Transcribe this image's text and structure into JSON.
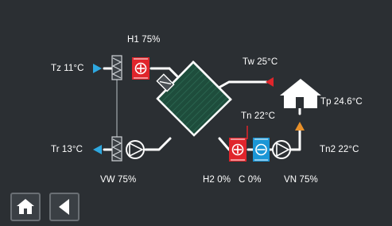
{
  "labels": {
    "h1": "H1 75%",
    "tz": "Tz 11°C",
    "tr": "Tr 13°C",
    "vw": "VW 75%",
    "tw": "Tw 25°C",
    "tn": "Tn 22°C",
    "tp": "Tp 24.6°C",
    "tn2": "Tn2 22°C",
    "h2": "H2 0%",
    "c": "C 0%",
    "vn": "VN 75%"
  },
  "nav": {
    "home_icon": "home-icon",
    "back_icon": "back-arrow-icon"
  },
  "colors": {
    "background": "#2b2f33",
    "pipe": "#ffffff",
    "heater": "#e0252b",
    "cooler": "#1b96d6",
    "inlet_arrow": "#2ea8e0",
    "red_arrow": "#e0252b",
    "orange_arrow": "#e8902a",
    "exchanger": "#1e4d3c"
  }
}
